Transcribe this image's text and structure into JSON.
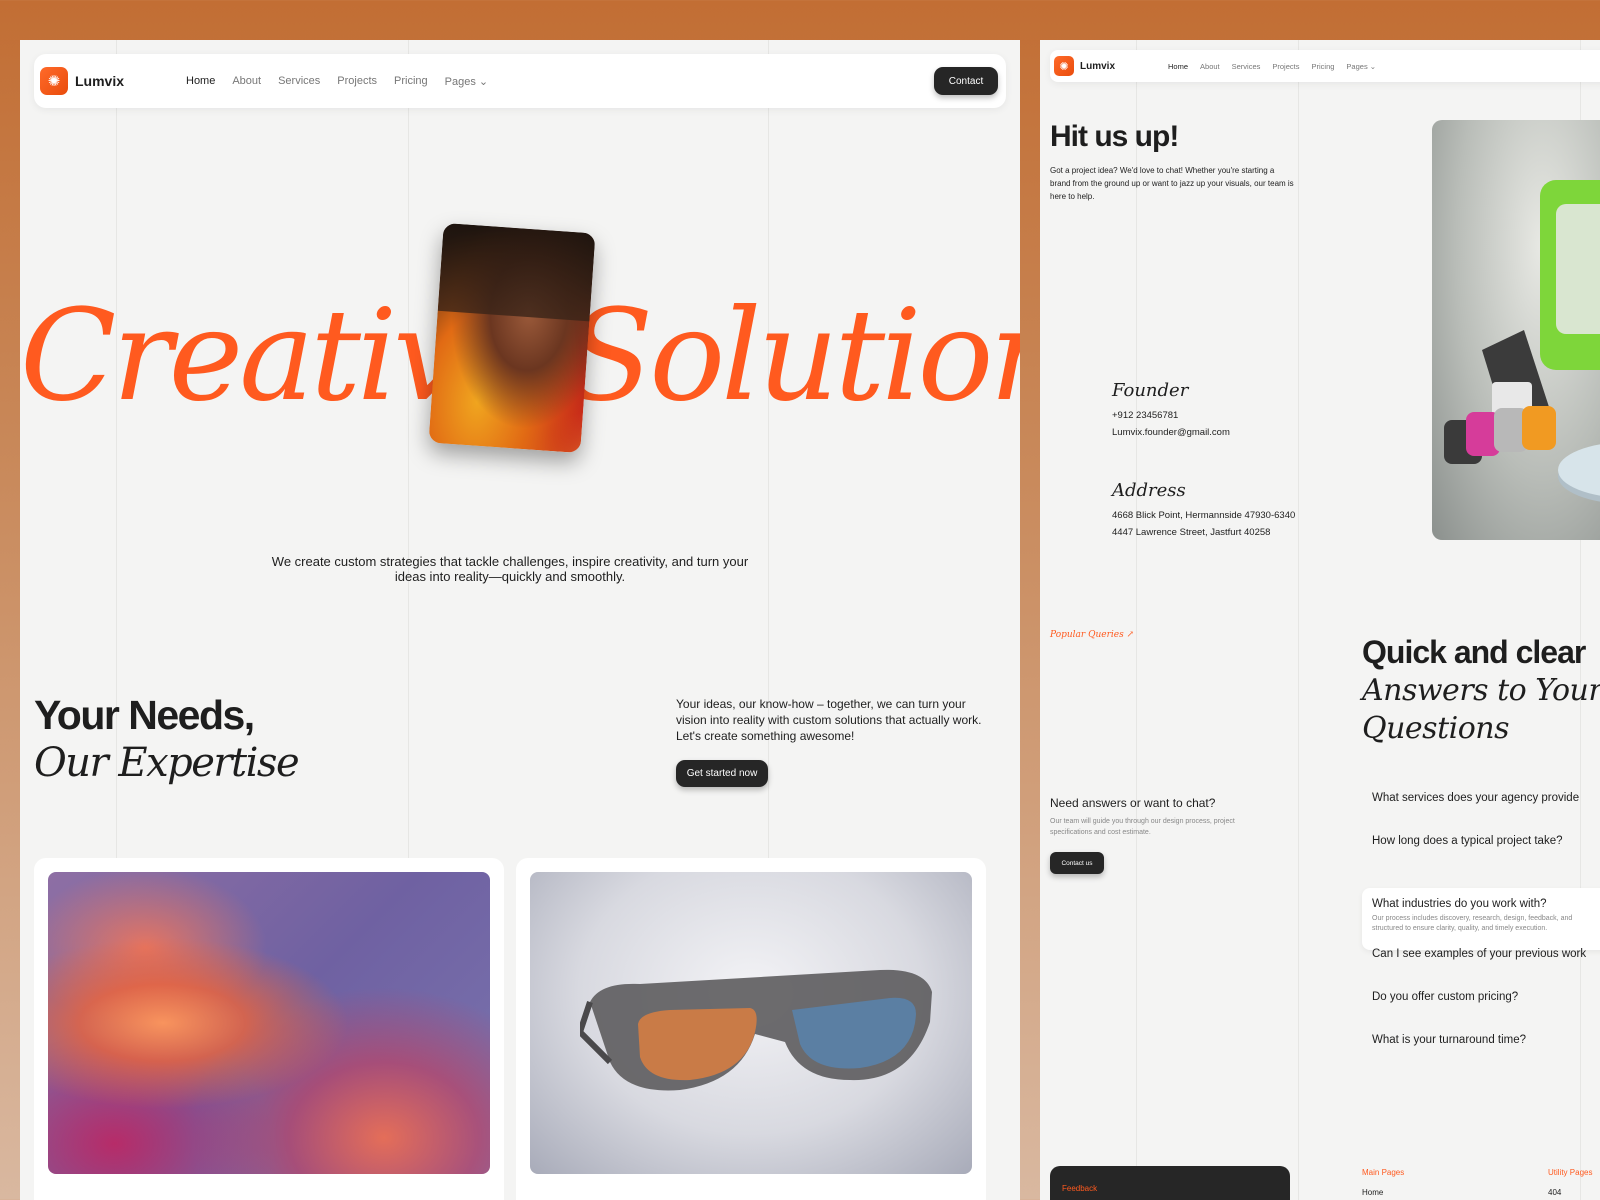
{
  "brand": {
    "name": "Lumvix",
    "accent": "#ff5a1f"
  },
  "nav": {
    "links": [
      "Home",
      "About",
      "Services",
      "Projects",
      "Pricing",
      "Pages"
    ],
    "contact_label": "Contact"
  },
  "home": {
    "hero_word": "Creative Solutions",
    "hero_sub": "We create custom strategies that tackle challenges, inspire creativity, and turn your ideas into reality—quickly and smoothly.",
    "needs_title": "Your Needs,",
    "needs_sub": "Our Expertise",
    "needs_desc": "Your ideas, our know-how – together, we can turn your vision into reality with custom solutions that actually work. Let's create something awesome!",
    "needs_button": "Get started now"
  },
  "contact": {
    "title": "Hit us up!",
    "desc": "Got a project idea? We'd love to chat! Whether you're starting a brand from the ground up or want to jazz up your visuals, our team is here to help.",
    "founder_label": "Founder",
    "founder_phone": "+912 23456781",
    "founder_email": "Lumvix.founder@gmail.com",
    "address_label": "Address",
    "address_1": "4668 Blick Point, Hermannside 47930-6340",
    "address_2": "4447 Lawrence Street, Jastfurt 40258"
  },
  "faq": {
    "tag": "Popular Queries ↗",
    "title": "Quick and clear",
    "sub_1": "Answers to Your key",
    "sub_2": "Questions",
    "chat_title": "Need answers or want to chat?",
    "chat_desc": "Our team will guide you through our design process, project specifications and cost estimate.",
    "chat_button": "Contact us",
    "items": [
      "What services does your agency provide",
      "How long does a typical project take?",
      "What industries do you work with?",
      "Can I see examples of your previous work",
      "Do you offer custom pricing?",
      "What is your turnaround time?"
    ],
    "open_answer_1": "Our process includes discovery, research, design, feedback, and",
    "open_answer_2": "structured to ensure clarity, quality, and timely execution."
  },
  "footer": {
    "feedback_label": "Feedback",
    "main_pages_label": "Main Pages",
    "main_pages_first": "Home",
    "utility_pages_label": "Utility Pages",
    "utility_pages_first": "404"
  }
}
